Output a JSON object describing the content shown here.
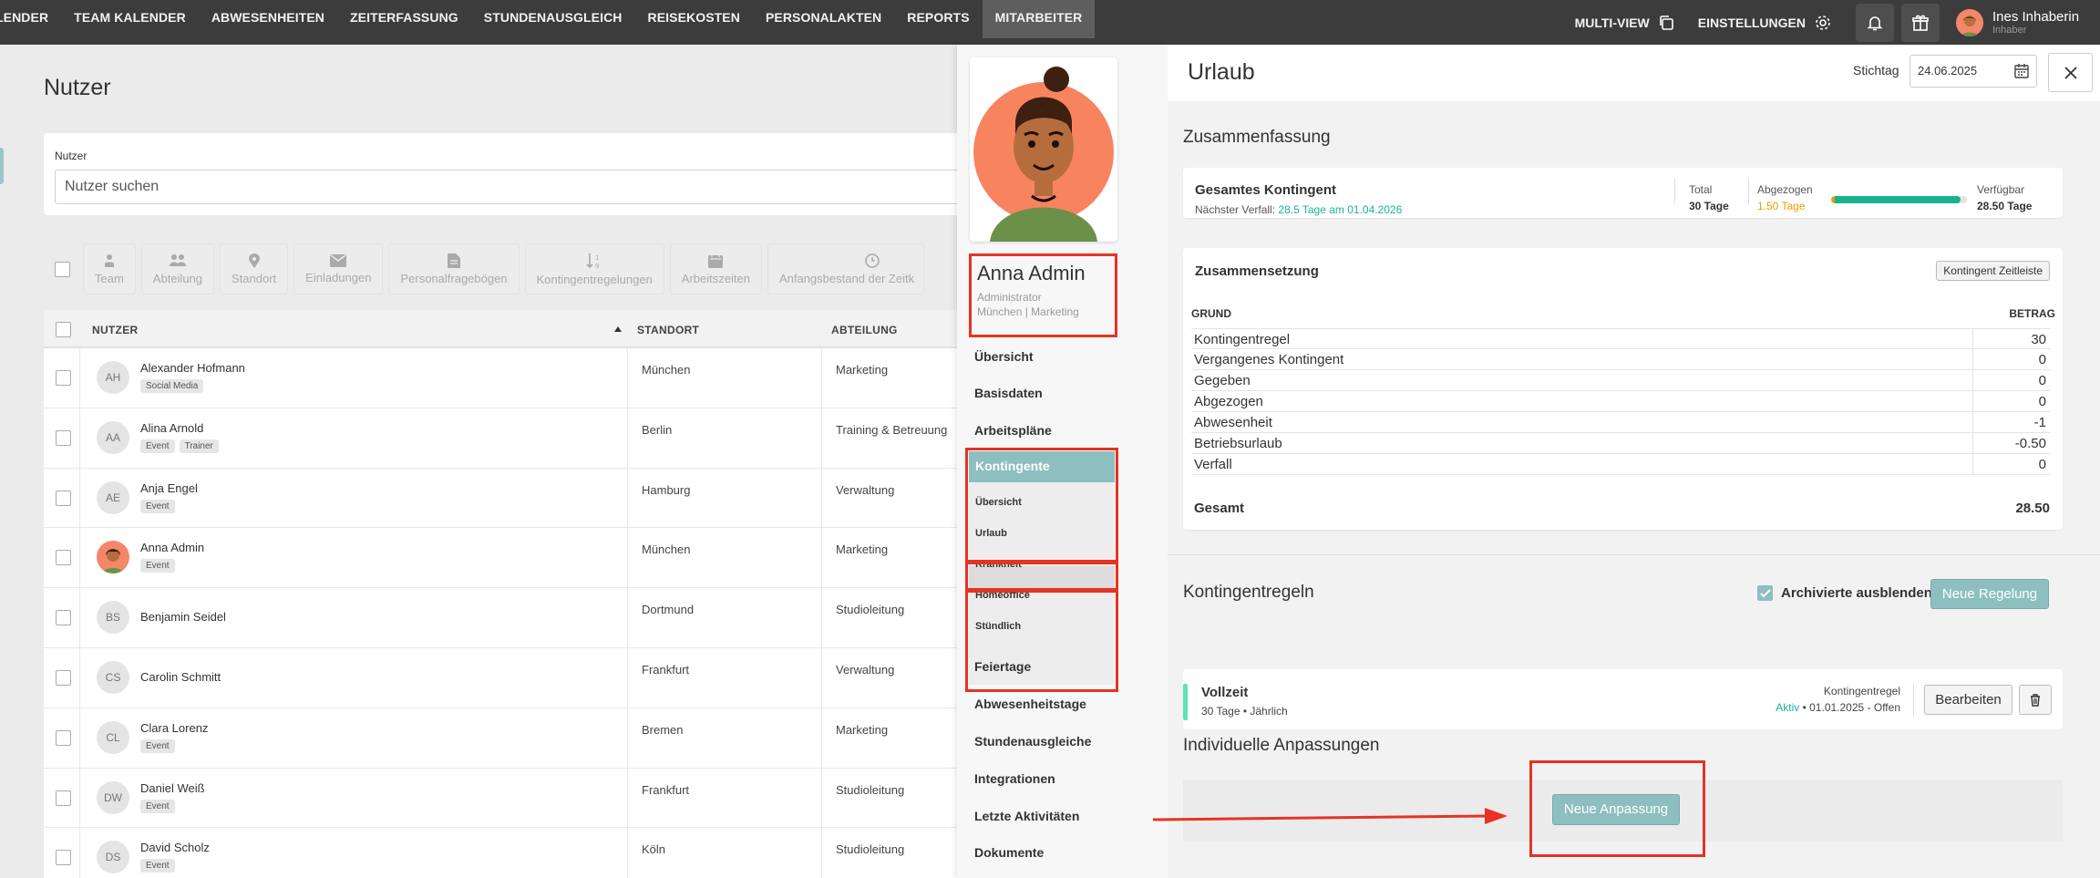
{
  "nav": {
    "items": [
      "LENDER",
      "TEAM KALENDER",
      "ABWESENHEITEN",
      "ZEITERFASSUNG",
      "STUNDENAUSGLEICH",
      "REISEKOSTEN",
      "PERSONALAKTEN",
      "REPORTS",
      "MITARBEITER"
    ],
    "multi_view": "MULTI-VIEW",
    "settings": "EINSTELLUNGEN",
    "user_name": "Ines Inhaberin",
    "user_role": "Inhaber"
  },
  "users_page": {
    "title": "Nutzer",
    "search_label": "Nutzer",
    "search_placeholder": "Nutzer suchen",
    "filters": [
      "Team",
      "Abteilung",
      "Standort",
      "Einladungen",
      "Personalfragebögen",
      "Kontingentregelungen",
      "Arbeitszeiten",
      "Anfangsbestand der Zeitk"
    ],
    "columns": {
      "user": "NUTZER",
      "location": "STANDORT",
      "department": "ABTEILUNG"
    },
    "rows": [
      {
        "initials": "AH",
        "name": "Alexander Hofmann",
        "tags": [
          "Social Media"
        ],
        "location": "München",
        "department": "Marketing"
      },
      {
        "initials": "AA",
        "name": "Alina Arnold",
        "tags": [
          "Event",
          "Trainer"
        ],
        "location": "Berlin",
        "department": "Training & Betreuung"
      },
      {
        "initials": "AE",
        "name": "Anja Engel",
        "tags": [
          "Event"
        ],
        "location": "Hamburg",
        "department": "Verwaltung"
      },
      {
        "initials": "",
        "name": "Anna Admin",
        "tags": [
          "Event"
        ],
        "location": "München",
        "department": "Marketing"
      },
      {
        "initials": "BS",
        "name": "Benjamin Seidel",
        "tags": [],
        "location": "Dortmund",
        "department": "Studioleitung"
      },
      {
        "initials": "CS",
        "name": "Carolin Schmitt",
        "tags": [],
        "location": "Frankfurt",
        "department": "Verwaltung"
      },
      {
        "initials": "CL",
        "name": "Clara Lorenz",
        "tags": [
          "Event"
        ],
        "location": "Bremen",
        "department": "Marketing"
      },
      {
        "initials": "DW",
        "name": "Daniel Weiß",
        "tags": [
          "Event"
        ],
        "location": "Frankfurt",
        "department": "Studioleitung"
      },
      {
        "initials": "DS",
        "name": "David Scholz",
        "tags": [
          "Event"
        ],
        "location": "Köln",
        "department": "Studioleitung"
      }
    ]
  },
  "profile": {
    "name": "Anna Admin",
    "role": "Administrator",
    "location_dept": "München | Marketing",
    "menu": {
      "uebersicht": "Übersicht",
      "basisdaten": "Basisdaten",
      "arbeitsplaene": "Arbeitspläne",
      "kontingente": "Kontingente",
      "sub_uebersicht": "Übersicht",
      "sub_urlaub": "Urlaub",
      "sub_krankheit": "Krankheit",
      "sub_homeoffice": "Homeoffice",
      "sub_stuendlich": "Stündlich",
      "feiertage": "Feiertage",
      "abwesenheitstage": "Abwesenheitstage",
      "stundenausgleiche": "Stundenausgleiche",
      "integrationen": "Integrationen",
      "letzte_aktivitaeten": "Letzte Aktivitäten",
      "dokumente": "Dokumente"
    }
  },
  "panel": {
    "title": "Urlaub",
    "stichtag_label": "Stichtag",
    "stichtag_value": "24.06.2025",
    "summary_title": "Zusammenfassung",
    "gesamtes_kontingent": "Gesamtes Kontingent",
    "naechster_verfall_label": "Nächster Verfall:",
    "naechster_verfall_value": "28.5 Tage am 01.04.2026",
    "total_label": "Total",
    "total_value": "30 Tage",
    "abgezogen_label": "Abgezogen",
    "abgezogen_value": "1.50 Tage",
    "verfuegbar_label": "Verfügbar",
    "verfuegbar_value": "28.50 Tage",
    "verfuegbar_fraction": 0.95,
    "zusammensetzung_title": "Zusammensetzung",
    "zeitleiste_button": "Kontingent Zeitleiste",
    "col_grund": "GRUND",
    "col_betrag": "BETRAG",
    "rows": [
      {
        "k": "Kontingentregel",
        "v": "30"
      },
      {
        "k": "Vergangenes Kontingent",
        "v": "0"
      },
      {
        "k": "Gegeben",
        "v": "0"
      },
      {
        "k": "Abgezogen",
        "v": "0"
      },
      {
        "k": "Abwesenheit",
        "v": "-1"
      },
      {
        "k": "Betriebsurlaub",
        "v": "-0.50"
      },
      {
        "k": "Verfall",
        "v": "0"
      }
    ],
    "gesamt_label": "Gesamt",
    "gesamt_value": "28.50",
    "rules_title": "Kontingentregeln",
    "archiv_label": "Archivierte ausblenden",
    "new_rule_button": "Neue Regelung",
    "rule_name": "Vollzeit",
    "rule_sub": "30 Tage • Jährlich",
    "rule_meta_label": "Kontingentregel",
    "rule_status": "Aktiv",
    "rule_period": " • 01.01.2025 - Offen",
    "edit_button": "Bearbeiten",
    "adjust_title": "Individuelle Anpassungen",
    "new_adjust_button": "Neue Anpassung"
  },
  "colors": {
    "accent": "#8dbfc0",
    "highlight": "#e63322",
    "topbar": "#3c3c3c",
    "green": "#17b38c",
    "orange": "#e6a100"
  }
}
